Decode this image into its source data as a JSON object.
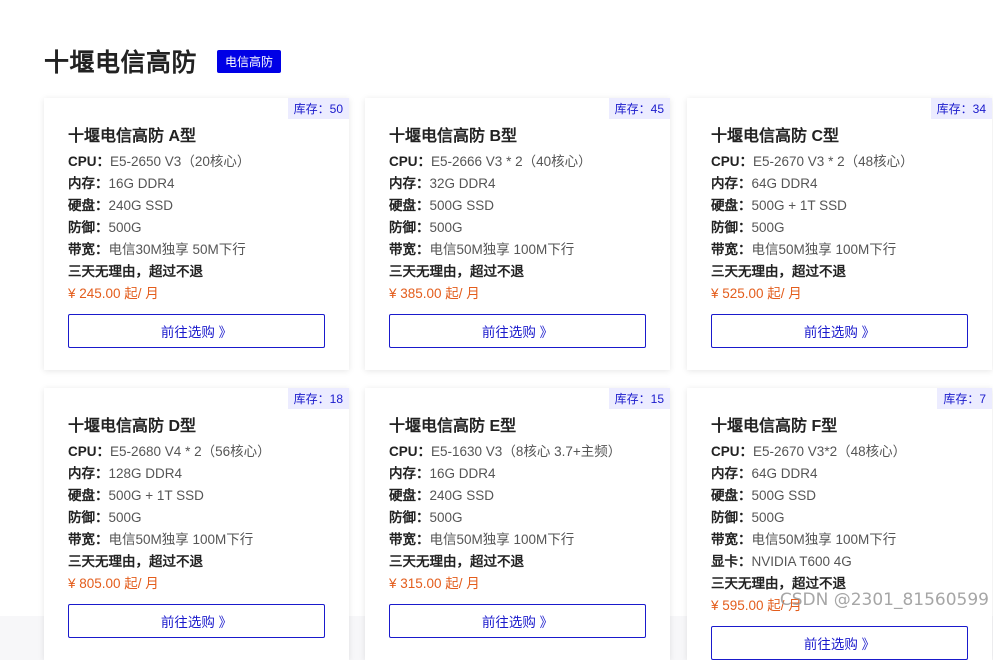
{
  "section": {
    "title": "十堰电信高防",
    "badge": "电信高防"
  },
  "cards": [
    {
      "stock": "库存：50",
      "title": "十堰电信高防 A型",
      "specs": [
        {
          "label": "CPU",
          "value": "E5-2650 V3（20核心）"
        },
        {
          "label": "内存",
          "value": "16G DDR4"
        },
        {
          "label": "硬盘",
          "value": "240G SSD"
        },
        {
          "label": "防御",
          "value": "500G"
        },
        {
          "label": "带宽",
          "value": "电信30M独享 50M下行"
        }
      ],
      "refund": "三天无理由，超过不退",
      "price": "¥ 245.00 起/ 月",
      "cta": "前往选购 》"
    },
    {
      "stock": "库存：45",
      "title": "十堰电信高防 B型",
      "specs": [
        {
          "label": "CPU",
          "value": "E5-2666 V3 * 2（40核心）"
        },
        {
          "label": "内存",
          "value": "32G DDR4"
        },
        {
          "label": "硬盘",
          "value": "500G SSD"
        },
        {
          "label": "防御",
          "value": "500G"
        },
        {
          "label": "带宽",
          "value": "电信50M独享 100M下行"
        }
      ],
      "refund": "三天无理由，超过不退",
      "price": "¥ 385.00 起/ 月",
      "cta": "前往选购 》"
    },
    {
      "stock": "库存：34",
      "title": "十堰电信高防 C型",
      "specs": [
        {
          "label": "CPU",
          "value": "E5-2670 V3 * 2（48核心）"
        },
        {
          "label": "内存",
          "value": "64G DDR4"
        },
        {
          "label": "硬盘",
          "value": "500G + 1T SSD"
        },
        {
          "label": "防御",
          "value": "500G"
        },
        {
          "label": "带宽",
          "value": "电信50M独享 100M下行"
        }
      ],
      "refund": "三天无理由，超过不退",
      "price": "¥ 525.00 起/ 月",
      "cta": "前往选购 》"
    },
    {
      "stock": "库存：18",
      "title": "十堰电信高防 D型",
      "specs": [
        {
          "label": "CPU",
          "value": "E5-2680 V4 * 2（56核心）"
        },
        {
          "label": "内存",
          "value": "128G DDR4"
        },
        {
          "label": "硬盘",
          "value": "500G + 1T SSD"
        },
        {
          "label": "防御",
          "value": "500G"
        },
        {
          "label": "带宽",
          "value": "电信50M独享 100M下行"
        }
      ],
      "refund": "三天无理由，超过不退",
      "price": "¥ 805.00 起/ 月",
      "cta": "前往选购 》"
    },
    {
      "stock": "库存：15",
      "title": "十堰电信高防 E型",
      "specs": [
        {
          "label": "CPU",
          "value": "E5-1630 V3（8核心 3.7+主频）"
        },
        {
          "label": "内存",
          "value": "16G DDR4"
        },
        {
          "label": "硬盘",
          "value": "240G SSD"
        },
        {
          "label": "防御",
          "value": "500G"
        },
        {
          "label": "带宽",
          "value": "电信50M独享 100M下行"
        }
      ],
      "refund": "三天无理由，超过不退",
      "price": "¥ 315.00 起/ 月",
      "cta": "前往选购 》"
    },
    {
      "stock": "库存：7",
      "title": "十堰电信高防 F型",
      "specs": [
        {
          "label": "CPU",
          "value": "E5-2670 V3*2（48核心）"
        },
        {
          "label": "内存",
          "value": "64G DDR4"
        },
        {
          "label": "硬盘",
          "value": "500G SSD"
        },
        {
          "label": "防御",
          "value": "500G"
        },
        {
          "label": "带宽",
          "value": "电信50M独享 100M下行"
        },
        {
          "label": "显卡",
          "value": "NVIDIA T600 4G"
        }
      ],
      "refund": "三天无理由，超过不退",
      "price": "¥ 595.00 起/ 月",
      "cta": "前往选购 》"
    }
  ],
  "watermark": "CSDN @2301_81560599",
  "colors": {
    "accent": "#1a1acc",
    "badge_bg": "#0000e6",
    "price": "#e35d1c",
    "stock_bg": "#ececff"
  }
}
